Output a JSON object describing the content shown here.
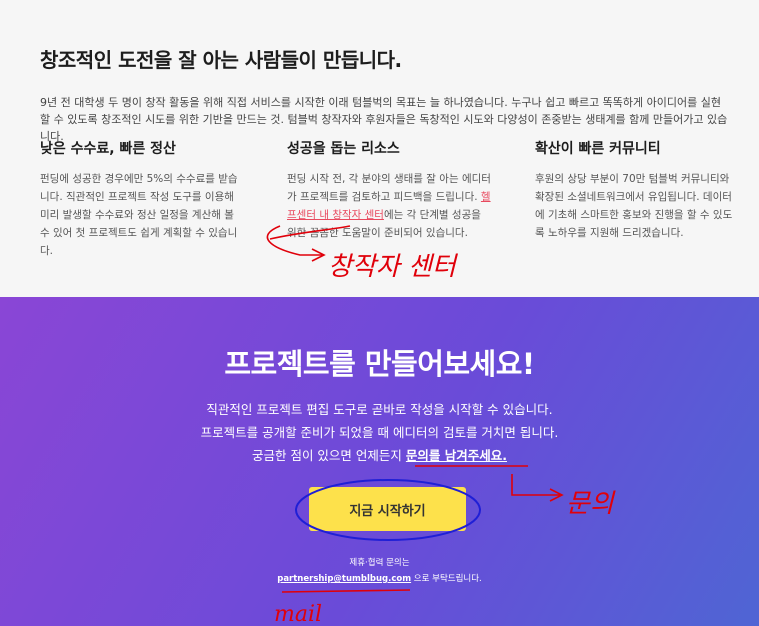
{
  "about": {
    "title": "창조적인 도전을 잘 아는 사람들이 만듭니다.",
    "intro": "9년 전 대학생 두 명이 창작 활동을 위해 직접 서비스를 시작한 이래 텀블벅의 목표는 늘 하나였습니다. 누구나 쉽고 빠르고 똑똑하게 아이디어를 실현할 수 있도록 창조적인 시도를 위한 기반을 만드는 것. 텀블벅 창작자와 후원자들은 독창적인 시도와 다양성이 존중받는 생태계를 함께 만들어가고 있습니다.",
    "features": [
      {
        "heading": "낮은 수수료, 빠른 정산",
        "text": "펀딩에 성공한 경우에만 5%의 수수료를 받습니다. 직관적인 프로젝트 작성 도구를 이용해 미리 발생할 수수료와 정산 일정을 계산해 볼 수 있어 첫 프로젝트도 쉽게 계획할 수 있습니다."
      },
      {
        "heading": "성공을 돕는 리소스",
        "text_before": "펀딩 시작 전, 각 분야의 생태를 잘 아는 에디터가 프로젝트를 검토하고 피드백을 드립니다. ",
        "link": "헬프센터 내 창작자 센터",
        "text_after": "에는 각 단계별 성공을 위한 꼼꼼한 도움말이 준비되어 있습니다."
      },
      {
        "heading": "확산이 빠른 커뮤니티",
        "text": "후원의 상당 부분이 70만 텀블벅 커뮤니티와 확장된 소셜네트워크에서 유입됩니다. 데이터에 기초해 스마트한 홍보와 진행을 할 수 있도록 노하우를 지원해 드리겠습니다."
      }
    ]
  },
  "hero": {
    "title": "프로젝트를 만들어보세요!",
    "line1": "직관적인 프로젝트 편집 도구로 곧바로 작성을 시작할 수 있습니다.",
    "line2": "프로젝트를 공개할 준비가 되었을 때 에디터의 검토를 거치면 됩니다.",
    "line3_prefix": "궁금한 점이 있으면 언제든지 ",
    "inquiry_link": "문의를 남겨주세요.",
    "start_button": "지금 시작하기",
    "partner_label": "제휴·협력 문의는",
    "partner_email": "partnership@tumblbug.com",
    "partner_suffix": " 으로 부탁드립니다."
  },
  "annotations": {
    "creator_center": "창작자 센터",
    "inquiry": "문의",
    "mail": "mail",
    "color": "#e0000a"
  },
  "colors": {
    "link_red": "#e84a5f",
    "button_yellow": "#fde14b",
    "hero_start": "#8a46d6",
    "hero_end": "#4f65d4"
  }
}
